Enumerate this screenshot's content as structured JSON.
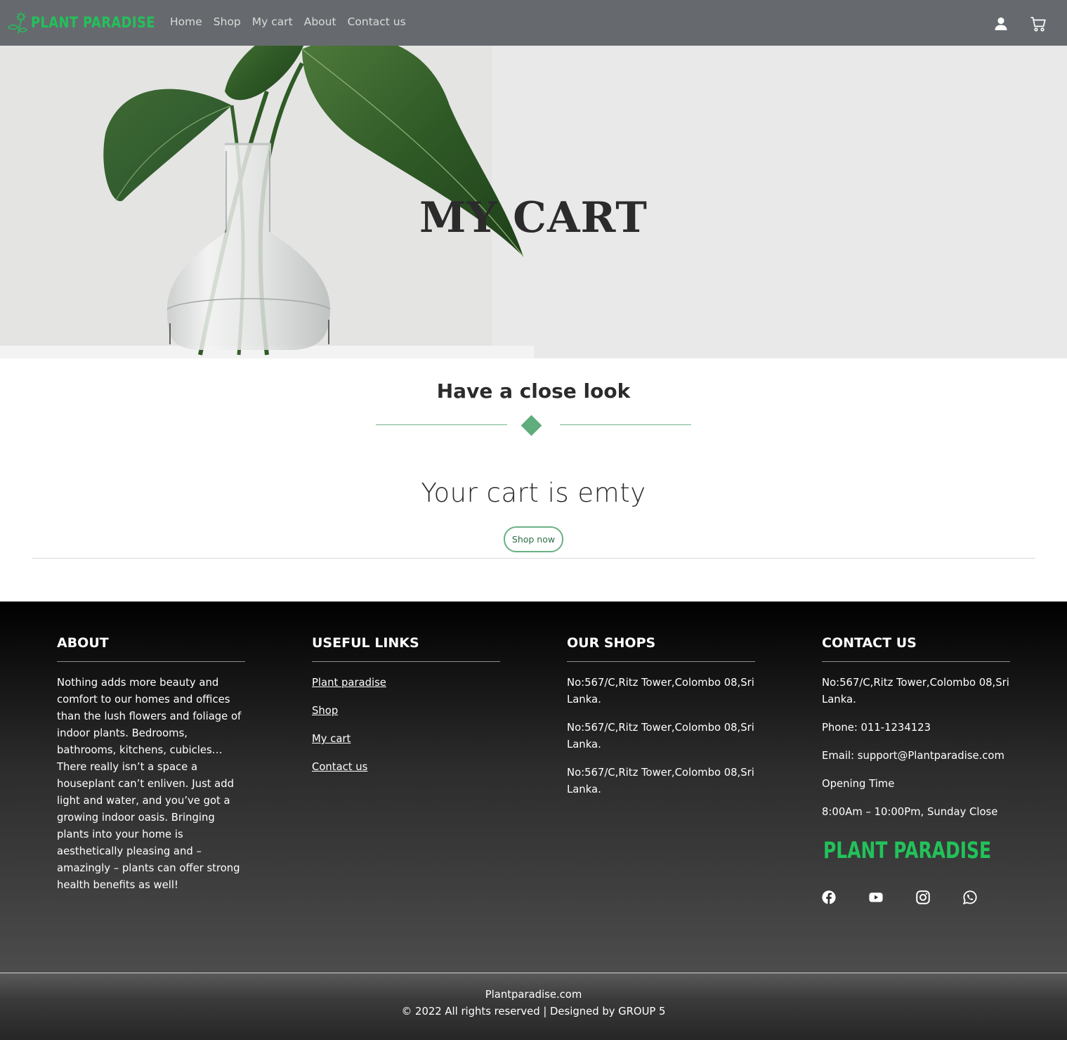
{
  "brand": {
    "name": "PLANT PARADISE",
    "color": "#22c25a"
  },
  "nav": {
    "links": [
      "Home",
      "Shop",
      "My cart",
      "About",
      "Contact us"
    ],
    "icons": [
      "user-icon",
      "cart-icon"
    ]
  },
  "hero": {
    "title": "MY CART"
  },
  "section": {
    "title": "Have a close look",
    "accent": "#5fac7c"
  },
  "cart": {
    "empty_message": "Your cart is emty",
    "shop_button": "Shop now"
  },
  "footer": {
    "about": {
      "heading": "ABOUT",
      "text": "Nothing adds more beauty and comfort to our homes and offices than the lush flowers and foliage of indoor plants. Bedrooms, bathrooms, kitchens, cubicles… There really isn’t a space a houseplant can’t enliven. Just add light and water, and you’ve got a growing indoor oasis. Bringing plants into your home is aesthetically pleasing and – amazingly – plants can offer strong health benefits as well!"
    },
    "links": {
      "heading": "USEFUL LINKS",
      "items": [
        "Plant paradise",
        "Shop",
        "My cart",
        "Contact us"
      ]
    },
    "shops": {
      "heading": "OUR SHOPS",
      "items": [
        "No:567/C,Ritz Tower,Colombo 08,Sri Lanka.",
        "No:567/C,Ritz Tower,Colombo 08,Sri Lanka.",
        "No:567/C,Ritz Tower,Colombo 08,Sri Lanka."
      ]
    },
    "contact": {
      "heading": "CONTACT US",
      "address": "No:567/C,Ritz Tower,Colombo 08,Sri Lanka.",
      "phone": "Phone: 011-1234123",
      "email": "Email: support@Plantparadise.com",
      "opening_label": "Opening Time",
      "opening_hours": "8:00Am – 10:00Pm, Sunday Close",
      "logo_text": "PLANT PARADISE",
      "socials": [
        "facebook-icon",
        "youtube-icon",
        "instagram-icon",
        "whatsapp-icon"
      ]
    },
    "bottom": {
      "site": "Plantparadise.com",
      "copyright": "© 2022 All rights reserved | Designed by GROUP 5"
    }
  }
}
